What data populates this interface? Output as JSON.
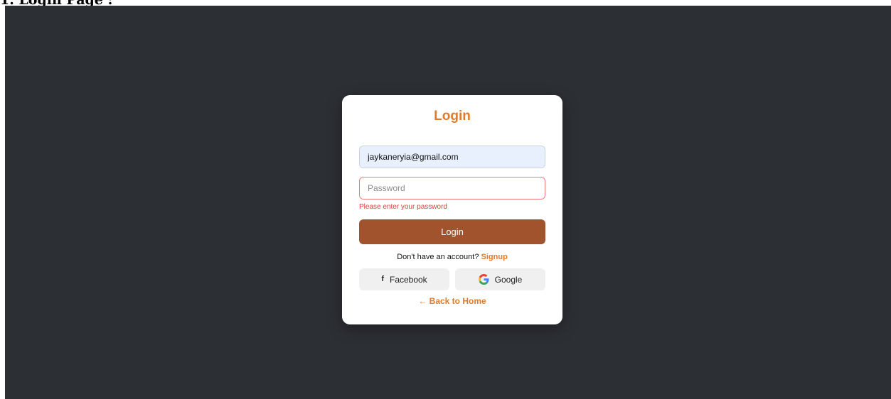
{
  "doc_heading": "1. Login Page :",
  "login_form": {
    "title": "Login",
    "email_value": "jaykaneryia@gmail.com",
    "password_placeholder": "Password",
    "password_error": "Please enter your password",
    "login_button_label": "Login",
    "signup_prompt": "Don't have an account?",
    "signup_link_label": "Signup",
    "facebook_button_label": "Facebook",
    "google_button_label": "Google",
    "back_home_label": "← Back to Home"
  },
  "colors": {
    "backdrop": "#2c2f34",
    "accent": "#e07b2b",
    "login_button": "#a0532d",
    "error": "#e33b3b"
  },
  "icons": {
    "facebook": "facebook-icon",
    "google": "google-icon"
  }
}
